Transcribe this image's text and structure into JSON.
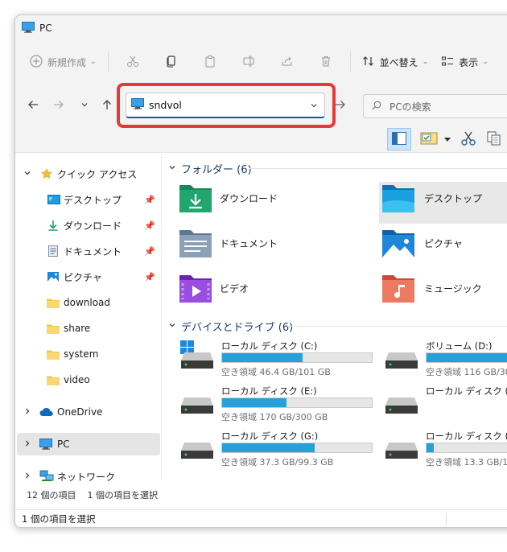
{
  "window": {
    "title": "PC"
  },
  "commandbar": {
    "new_label": "新規作成",
    "sort_label": "並べ替え",
    "view_label": "表示"
  },
  "address": {
    "value": "sndvol"
  },
  "search": {
    "placeholder": "PCの検索"
  },
  "sidebar": {
    "quick_access": "クイック アクセス",
    "items": [
      {
        "label": "デスクトップ",
        "icon": "desktop-icon"
      },
      {
        "label": "ダウンロード",
        "icon": "download-icon"
      },
      {
        "label": "ドキュメント",
        "icon": "documents-icon"
      },
      {
        "label": "ピクチャ",
        "icon": "pictures-icon"
      },
      {
        "label": "download",
        "icon": "folder-icon"
      },
      {
        "label": "share",
        "icon": "folder-icon"
      },
      {
        "label": "system",
        "icon": "folder-icon"
      },
      {
        "label": "video",
        "icon": "folder-icon"
      }
    ],
    "onedrive": "OneDrive",
    "pc": "PC",
    "network": "ネットワーク",
    "status_count": "12 個の項目",
    "status_selected": "1 個の項目を選択"
  },
  "main": {
    "folders_header": "フォルダー (6)",
    "folders": [
      {
        "name": "ダウンロード",
        "color": "#1e9e6a"
      },
      {
        "name": "デスクトップ",
        "color": "#1aa0e0"
      },
      {
        "name": "ドキュメント",
        "color": "#7a8fa8"
      },
      {
        "name": "ピクチャ",
        "color": "#1f86d8"
      },
      {
        "name": "ビデオ",
        "color": "#8a3ed1"
      },
      {
        "name": "ミュージック",
        "color": "#e9745b"
      }
    ],
    "drives_header": "デバイスとドライブ (6)",
    "drives": [
      {
        "name": "ローカル ディスク (C:)",
        "free": "空き領域 46.4 GB/101 GB",
        "used_fraction": 0.54
      },
      {
        "name": "ボリューム (D:)",
        "free": "空き領域 116 GB/30",
        "used_fraction": 0.6
      },
      {
        "name": "ローカル ディスク (E:)",
        "free": "空き領域 170 GB/300 GB",
        "used_fraction": 0.43
      },
      {
        "name": "ローカル ディスク (F:)",
        "free": "",
        "used_fraction": 0
      },
      {
        "name": "ローカル ディスク (G:)",
        "free": "空き領域 37.3 GB/99.3 GB",
        "used_fraction": 0.62
      },
      {
        "name": "ローカル ディスク (H:)",
        "free": "空き領域 13.3 GB/1",
        "used_fraction": 0.05
      }
    ]
  },
  "statusbar": {
    "text": "1 個の項目を選択"
  },
  "colors": {
    "accent": "#005fb8",
    "highlight": "#e63a3a",
    "bar_fill": "#26a0da"
  }
}
